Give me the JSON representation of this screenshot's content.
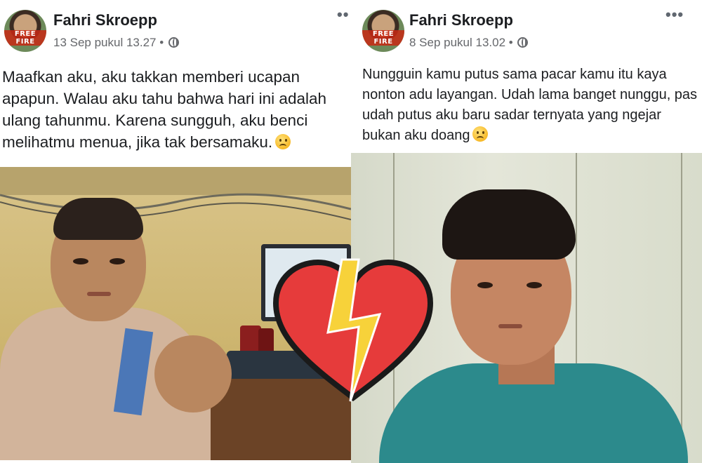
{
  "posts": [
    {
      "author": "Fahri Skroepp",
      "avatar_badge": "FREE FIRE",
      "timestamp": "13 Sep pukul 13.27",
      "separator": "•",
      "privacy_icon": "globe-icon",
      "more_icon": "ellipsis-icon",
      "more": "••",
      "text": "Maafkan aku, aku takkan memberi ucapan apapun. Walau aku tahu bahwa hari ini adalah ulang tahunmu. Karena sungguh, aku benci melihatmu menua, jika tak bersamaku.",
      "emoji": "frowning-face"
    },
    {
      "author": "Fahri Skroepp",
      "avatar_badge": "FREE FIRE",
      "timestamp": "8 Sep pukul 13.02",
      "separator": "•",
      "privacy_icon": "globe-icon",
      "more_icon": "ellipsis-icon",
      "more": "•••",
      "text": "Nungguin kamu putus sama pacar kamu itu kaya nonton adu layangan. Udah lama banget nunggu, pas udah putus aku baru sadar ternyata yang ngejar bukan aku doang",
      "emoji": "frowning-face"
    }
  ],
  "overlay": {
    "icon": "broken-heart-icon",
    "colors": {
      "heart": "#e63b3b",
      "bolt": "#f7d23a"
    }
  }
}
